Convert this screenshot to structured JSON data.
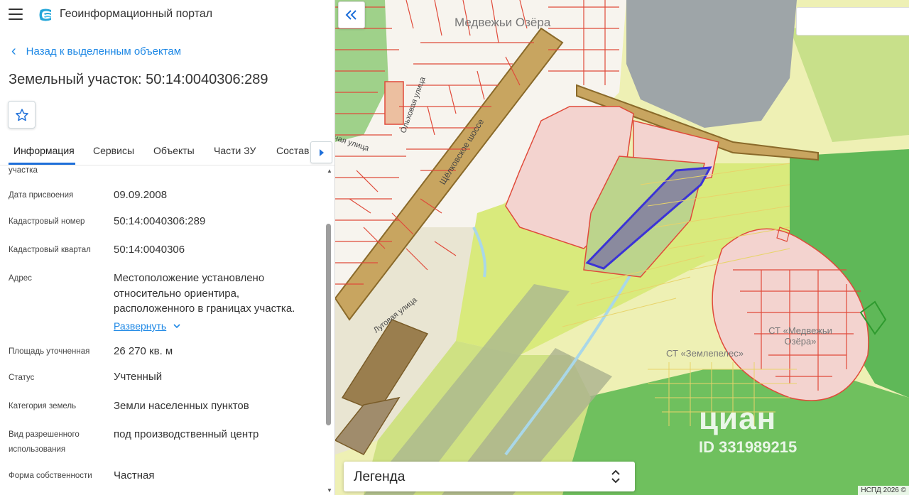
{
  "header": {
    "app_title": "Геоинформационный портал"
  },
  "back": {
    "label": "Назад к выделенным объектам"
  },
  "parcel": {
    "title": "Земельный участок: 50:14:0040306:289"
  },
  "tabs": [
    {
      "label": "Информация"
    },
    {
      "label": "Сервисы"
    },
    {
      "label": "Объекты"
    },
    {
      "label": "Части ЗУ"
    },
    {
      "label": "Состав"
    }
  ],
  "info": {
    "partial_top": "участка",
    "rows": [
      {
        "label": "Дата присвоения",
        "value": "09.09.2008"
      },
      {
        "label": "Кадастровый номер",
        "value": "50:14:0040306:289"
      },
      {
        "label": "Кадастровый квартал",
        "value": "50:14:0040306"
      },
      {
        "label": "Адрес",
        "value": "Местоположение установлено относительно ориентира, расположенного в границах участка."
      },
      {
        "label": "Площадь уточненная",
        "value": "26 270 кв. м"
      },
      {
        "label": "Статус",
        "value": "Учтенный"
      },
      {
        "label": "Категория земель",
        "value": "Земли населенных пунктов"
      },
      {
        "label": "Вид разрешенного использования",
        "value": "под производственный центр"
      },
      {
        "label": "Форма собственности",
        "value": "Частная"
      }
    ],
    "expand_label": "Развернуть"
  },
  "map": {
    "labels": {
      "town": "Медвежьи Озёра",
      "highway": "Щёлковское шоссе",
      "street_olhovaya": "Ольховая улица",
      "street_lugovaya": "Луговая улица",
      "street_partial": "ная улица",
      "st_medvezhi": "СТ «Медвежьи Озёра»",
      "st_zemlepeles": "СТ «Землепелес»"
    },
    "watermark": "циан",
    "watermark_id": "ID 331989215"
  },
  "legend": {
    "title": "Легенда"
  },
  "copyright": "НСПД 2026 ©",
  "colors": {
    "accent": "#1e88e5",
    "parcel_outline": "#e04a3a",
    "selected_parcel": "#3b33d6",
    "water": "#9ea5a8",
    "forest": "#6fbf5f"
  }
}
